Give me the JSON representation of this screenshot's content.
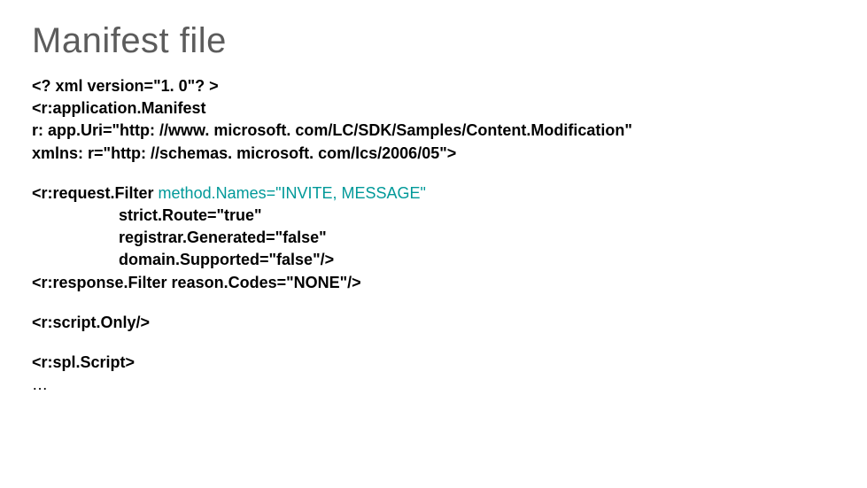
{
  "title": "Manifest file",
  "code": {
    "line1": "<? xml version=\"1. 0\"? >",
    "line2": "<r:application.Manifest",
    "line3": "r: app.Uri=\"http: //www. microsoft. com/LC/SDK/Samples/Content.Modification\"",
    "line4": "xmlns: r=\"http: //schemas. microsoft. com/lcs/2006/05\">",
    "line5_part1": "<r:request.Filter ",
    "line5_highlight": "method.Names=\"INVITE, MESSAGE\"",
    "line6": "strict.Route=\"true\"",
    "line7": "registrar.Generated=\"false\"",
    "line8": "domain.Supported=\"false\"/>",
    "line9": "<r:response.Filter reason.Codes=\"NONE\"/>",
    "line10": "<r:script.Only/>",
    "line11": "<r:spl.Script>",
    "line12": "…"
  }
}
